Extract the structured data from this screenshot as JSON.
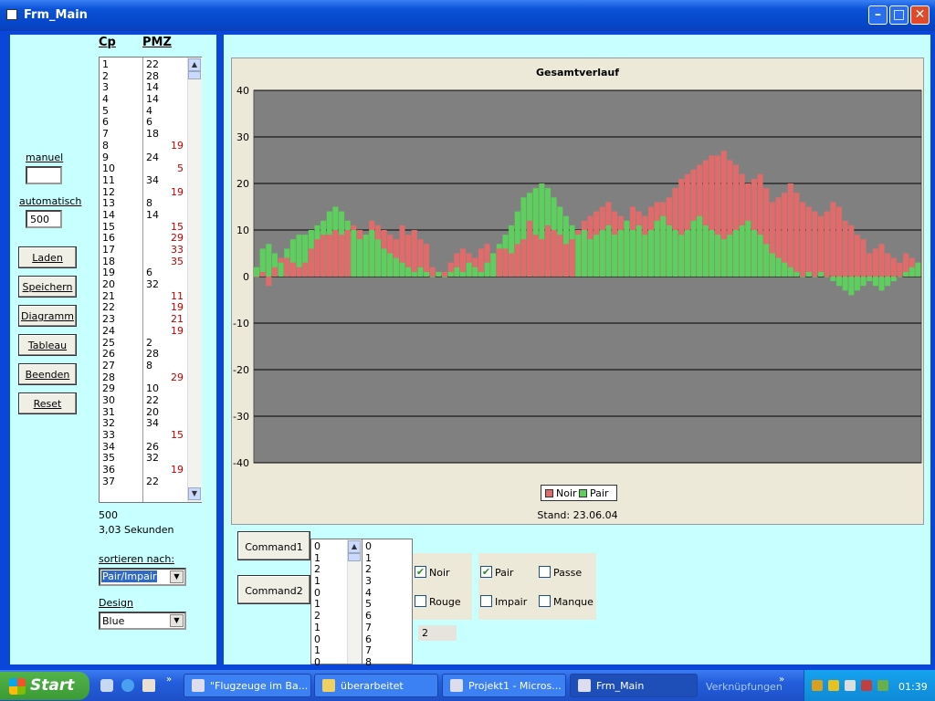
{
  "window": {
    "title": "Frm_Main"
  },
  "left": {
    "header_cp": "Cp",
    "header_pmz": "PMZ",
    "manuel_label": "manuel",
    "manuel_value": "",
    "automatisch_label": "automatisch",
    "automatisch_value": "500",
    "buttons": {
      "laden": "Laden",
      "speichern": "Speichern",
      "diagramm": "Diagramm",
      "tableau": "Tableau",
      "beenden": "Beenden",
      "reset": "Reset"
    },
    "rows": [
      {
        "cp": "1",
        "pmz": "22",
        "red": ""
      },
      {
        "cp": "2",
        "pmz": "28",
        "red": ""
      },
      {
        "cp": "3",
        "pmz": "14",
        "red": ""
      },
      {
        "cp": "4",
        "pmz": "14",
        "red": ""
      },
      {
        "cp": "5",
        "pmz": "4",
        "red": ""
      },
      {
        "cp": "6",
        "pmz": "6",
        "red": ""
      },
      {
        "cp": "7",
        "pmz": "18",
        "red": ""
      },
      {
        "cp": "8",
        "pmz": "",
        "red": "19"
      },
      {
        "cp": "9",
        "pmz": "24",
        "red": ""
      },
      {
        "cp": "10",
        "pmz": "",
        "red": "5"
      },
      {
        "cp": "11",
        "pmz": "34",
        "red": ""
      },
      {
        "cp": "12",
        "pmz": "",
        "red": "19"
      },
      {
        "cp": "13",
        "pmz": "8",
        "red": ""
      },
      {
        "cp": "14",
        "pmz": "14",
        "red": ""
      },
      {
        "cp": "15",
        "pmz": "",
        "red": "15"
      },
      {
        "cp": "16",
        "pmz": "",
        "red": "29"
      },
      {
        "cp": "17",
        "pmz": "",
        "red": "33"
      },
      {
        "cp": "18",
        "pmz": "",
        "red": "35"
      },
      {
        "cp": "19",
        "pmz": "6",
        "red": ""
      },
      {
        "cp": "20",
        "pmz": "32",
        "red": ""
      },
      {
        "cp": "21",
        "pmz": "",
        "red": "11"
      },
      {
        "cp": "22",
        "pmz": "",
        "red": "19"
      },
      {
        "cp": "23",
        "pmz": "",
        "red": "21"
      },
      {
        "cp": "24",
        "pmz": "",
        "red": "19"
      },
      {
        "cp": "25",
        "pmz": "2",
        "red": ""
      },
      {
        "cp": "26",
        "pmz": "28",
        "red": ""
      },
      {
        "cp": "27",
        "pmz": "8",
        "red": ""
      },
      {
        "cp": "28",
        "pmz": "",
        "red": "29"
      },
      {
        "cp": "29",
        "pmz": "10",
        "red": ""
      },
      {
        "cp": "30",
        "pmz": "22",
        "red": ""
      },
      {
        "cp": "31",
        "pmz": "20",
        "red": ""
      },
      {
        "cp": "32",
        "pmz": "34",
        "red": ""
      },
      {
        "cp": "33",
        "pmz": "",
        "red": "15"
      },
      {
        "cp": "34",
        "pmz": "26",
        "red": ""
      },
      {
        "cp": "35",
        "pmz": "32",
        "red": ""
      },
      {
        "cp": "36",
        "pmz": "",
        "red": "19"
      },
      {
        "cp": "37",
        "pmz": "22",
        "red": ""
      }
    ],
    "count_value": "500",
    "time_value": "3,03 Sekunden",
    "sort_label": "sortieren nach:",
    "sort_value": "Pair/Impair",
    "design_label": "Design",
    "design_value": "Blue"
  },
  "chart_data": {
    "type": "bar",
    "title": "Gesamtverlauf",
    "ylim": [
      -40,
      40
    ],
    "yticks": [
      "40",
      "30",
      "20",
      "10",
      "0",
      "-10",
      "-20",
      "-30",
      "-40"
    ],
    "grid": true,
    "legend": "bottom-center",
    "footer": "Stand: 23.06.04",
    "series": [
      {
        "name": "Noir",
        "color": "#e06b6b",
        "values": [
          0,
          1,
          -2,
          2,
          4,
          4,
          3,
          2,
          3,
          6,
          8,
          9,
          9,
          10,
          9,
          10,
          11,
          10,
          9,
          12,
          11,
          10,
          9,
          8,
          11,
          9,
          10,
          8,
          7,
          2,
          1,
          1,
          3,
          5,
          6,
          5,
          4,
          6,
          7,
          5,
          6,
          6,
          5,
          7,
          8,
          12,
          9,
          8,
          11,
          10,
          9,
          7,
          8,
          10,
          12,
          13,
          14,
          15,
          16,
          14,
          13,
          12,
          15,
          14,
          13,
          15,
          16,
          16,
          17,
          19,
          21,
          22,
          23,
          24,
          25,
          26,
          26,
          27,
          25,
          24,
          22,
          20,
          21,
          22,
          19,
          16,
          17,
          18,
          20,
          18,
          16,
          15,
          14,
          13,
          14,
          16,
          15,
          12,
          11,
          9,
          8,
          5,
          6,
          7,
          5,
          4,
          3,
          5,
          4,
          3
        ]
      },
      {
        "name": "Pair",
        "color": "#5ece5e",
        "values": [
          2,
          6,
          7,
          5,
          3,
          6,
          8,
          9,
          9,
          10,
          11,
          12,
          14,
          15,
          14,
          12,
          10,
          8,
          9,
          10,
          8,
          6,
          5,
          4,
          3,
          2,
          1,
          2,
          1,
          0,
          1,
          0,
          1,
          2,
          1,
          3,
          2,
          1,
          3,
          5,
          7,
          9,
          11,
          14,
          17,
          18,
          19,
          20,
          19,
          17,
          15,
          13,
          11,
          9,
          10,
          8,
          9,
          10,
          11,
          9,
          10,
          12,
          10,
          11,
          9,
          10,
          12,
          13,
          11,
          10,
          9,
          10,
          12,
          13,
          11,
          10,
          9,
          8,
          9,
          10,
          11,
          12,
          10,
          9,
          7,
          5,
          4,
          3,
          2,
          1,
          0,
          1,
          0,
          1,
          0,
          -1,
          -2,
          -3,
          -4,
          -3,
          -2,
          -1,
          -2,
          -3,
          -2,
          -1,
          0,
          1,
          2,
          3
        ]
      }
    ]
  },
  "bottom": {
    "command1": "Command1",
    "command2": "Command2",
    "list1": [
      "0",
      "1",
      "2",
      "1",
      "0",
      "1",
      "2",
      "1",
      "0",
      "1",
      "0"
    ],
    "list2": [
      "0",
      "1",
      "2",
      "3",
      "4",
      "5",
      "6",
      "7",
      "6",
      "7",
      "8"
    ],
    "chk_noir": "Noir",
    "chk_rouge": "Rouge",
    "chk_pair": "Pair",
    "chk_impair": "Impair",
    "chk_passe": "Passe",
    "chk_manque": "Manque",
    "value_box": "2"
  },
  "taskbar": {
    "start": "Start",
    "tasks": [
      "\"Flugzeuge im Ba...",
      "überarbeitet",
      "Projekt1 - Micros...",
      "Frm_Main"
    ],
    "links": "Verknüpfungen",
    "clock": "01:39"
  }
}
